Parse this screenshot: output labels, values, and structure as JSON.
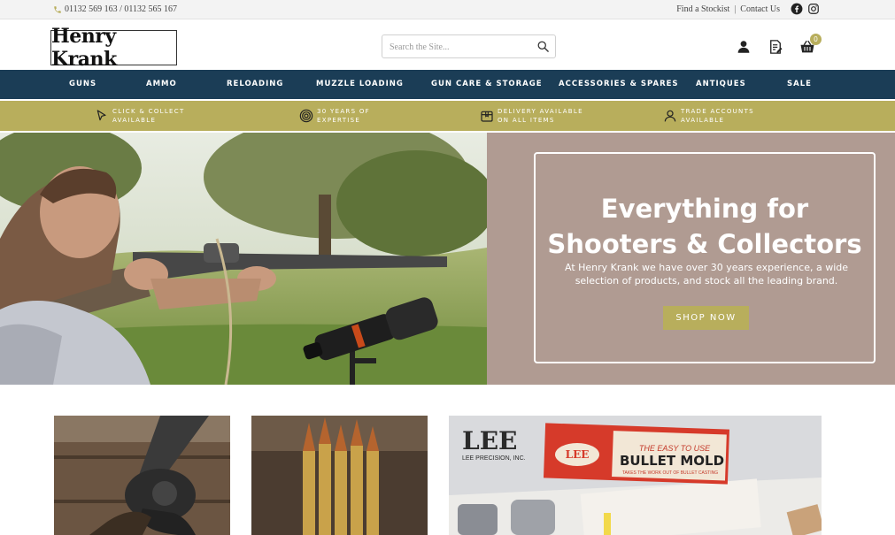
{
  "topbar": {
    "phone": "01132 569 163 / 01132 565 167",
    "links": [
      "Find a Stockist",
      "Contact Us"
    ],
    "separator": "|",
    "social": [
      "facebook-icon",
      "instagram-icon"
    ]
  },
  "header": {
    "logo_text": "Henry Krank",
    "search_placeholder": "Search the Site...",
    "icons": [
      "account-icon",
      "quote-list-icon",
      "basket-icon"
    ],
    "basket_count": "0"
  },
  "nav": {
    "items": [
      "GUNS",
      "AMMO",
      "RELOADING",
      "MUZZLE LOADING",
      "GUN CARE & STORAGE",
      "ACCESSORIES & SPARES",
      "ANTIQUES",
      "SALE"
    ]
  },
  "usp": [
    {
      "icon": "cursor-icon",
      "line1": "Click & Collect",
      "line2": "Available"
    },
    {
      "icon": "target-icon",
      "line1": "30 Years of",
      "line2": "Expertise"
    },
    {
      "icon": "package-icon",
      "line1": "Delivery Available",
      "line2": "On All Items"
    },
    {
      "icon": "user-icon",
      "line1": "Trade Accounts",
      "line2": "Available"
    }
  ],
  "hero": {
    "title_line1": "Everything for",
    "title_line2": "Shooters & Collectors",
    "subtitle_line1": "At Henry Krank we have over 30 years experience, a wide",
    "subtitle_line2": "selection of products, and stock all the leading brand.",
    "button": "SHOP NOW"
  },
  "tiles": {
    "lee_brand": "LEE",
    "lee_sub": "LEE PRECISION, INC.",
    "box_tagline": "THE EASY TO USE",
    "box_title": "BULLET MOLD",
    "box_small": "TAKES THE WORK OUT OF BULLET CASTING"
  },
  "colors": {
    "nav_bg": "#1b3d56",
    "accent_olive": "#b8ae5c",
    "hero_panel": "#b09b92",
    "topbar_bg": "#f3f3f3"
  }
}
